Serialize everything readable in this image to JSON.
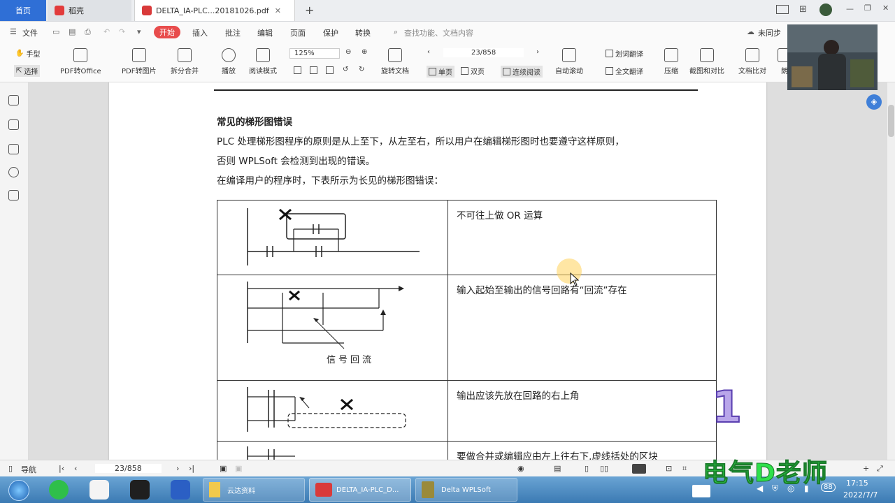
{
  "tabs": {
    "home": "首页",
    "doc1": "稻壳",
    "doc2": "DELTA_IA-PLC...20181026.pdf"
  },
  "menu": {
    "file": "文件",
    "start": "开始",
    "insert": "插入",
    "annotate": "批注",
    "edit": "编辑",
    "page": "页面",
    "protect": "保护",
    "convert": "转换",
    "search_placeholder": "查找功能、文档内容",
    "sync": "未同步"
  },
  "ribbon": {
    "hand": "手型",
    "select": "选择",
    "pdf_to_office": "PDF转Office",
    "pdf_to_image": "PDF转图片",
    "split_merge": "拆分合并",
    "play": "播放",
    "read_mode": "阅读模式",
    "zoom": "125%",
    "rotate": "旋转文档",
    "page_indicator": "23/858",
    "single": "单页",
    "double": "双页",
    "continuous": "连续阅读",
    "auto_scroll": "自动滚动",
    "translate_selection": "划词翻译",
    "translate_full": "全文翻译",
    "compress": "压缩",
    "screenshot_compare": "截图和对比",
    "doc_compare": "文档比对",
    "read_aloud": "朗"
  },
  "document": {
    "heading": "常见的梯形图错误",
    "para1": "PLC 处理梯形图程序的原则是从上至下，从左至右，所以用户在编辑梯形图时也要遵守这样原则，",
    "para2": "否则 WPLSoft 会检测到出现的错误。",
    "para3": "在编译用户的程序时，下表所示为长见的梯形图错误：",
    "rows": [
      {
        "desc": "不可往上做 OR 运算"
      },
      {
        "desc": "输入起始至输出的信号回路有“回流”存在",
        "caption": "信号回流"
      },
      {
        "desc": "输出应该先放在回路的右上角"
      },
      {
        "desc": "要做合并或编辑应由左上往右下,虚线括处的区块"
      }
    ]
  },
  "statusbar": {
    "nav": "导航",
    "page": "23/858"
  },
  "taskbar": {
    "app1": "云达资料",
    "app2": "DELTA_IA-PLC_D...",
    "app3": "Delta WPLSoft",
    "time": "17:15",
    "date": "2022/7/7",
    "badge": "88"
  },
  "overlay": {
    "watermark": "电气D老师",
    "number": "1"
  }
}
